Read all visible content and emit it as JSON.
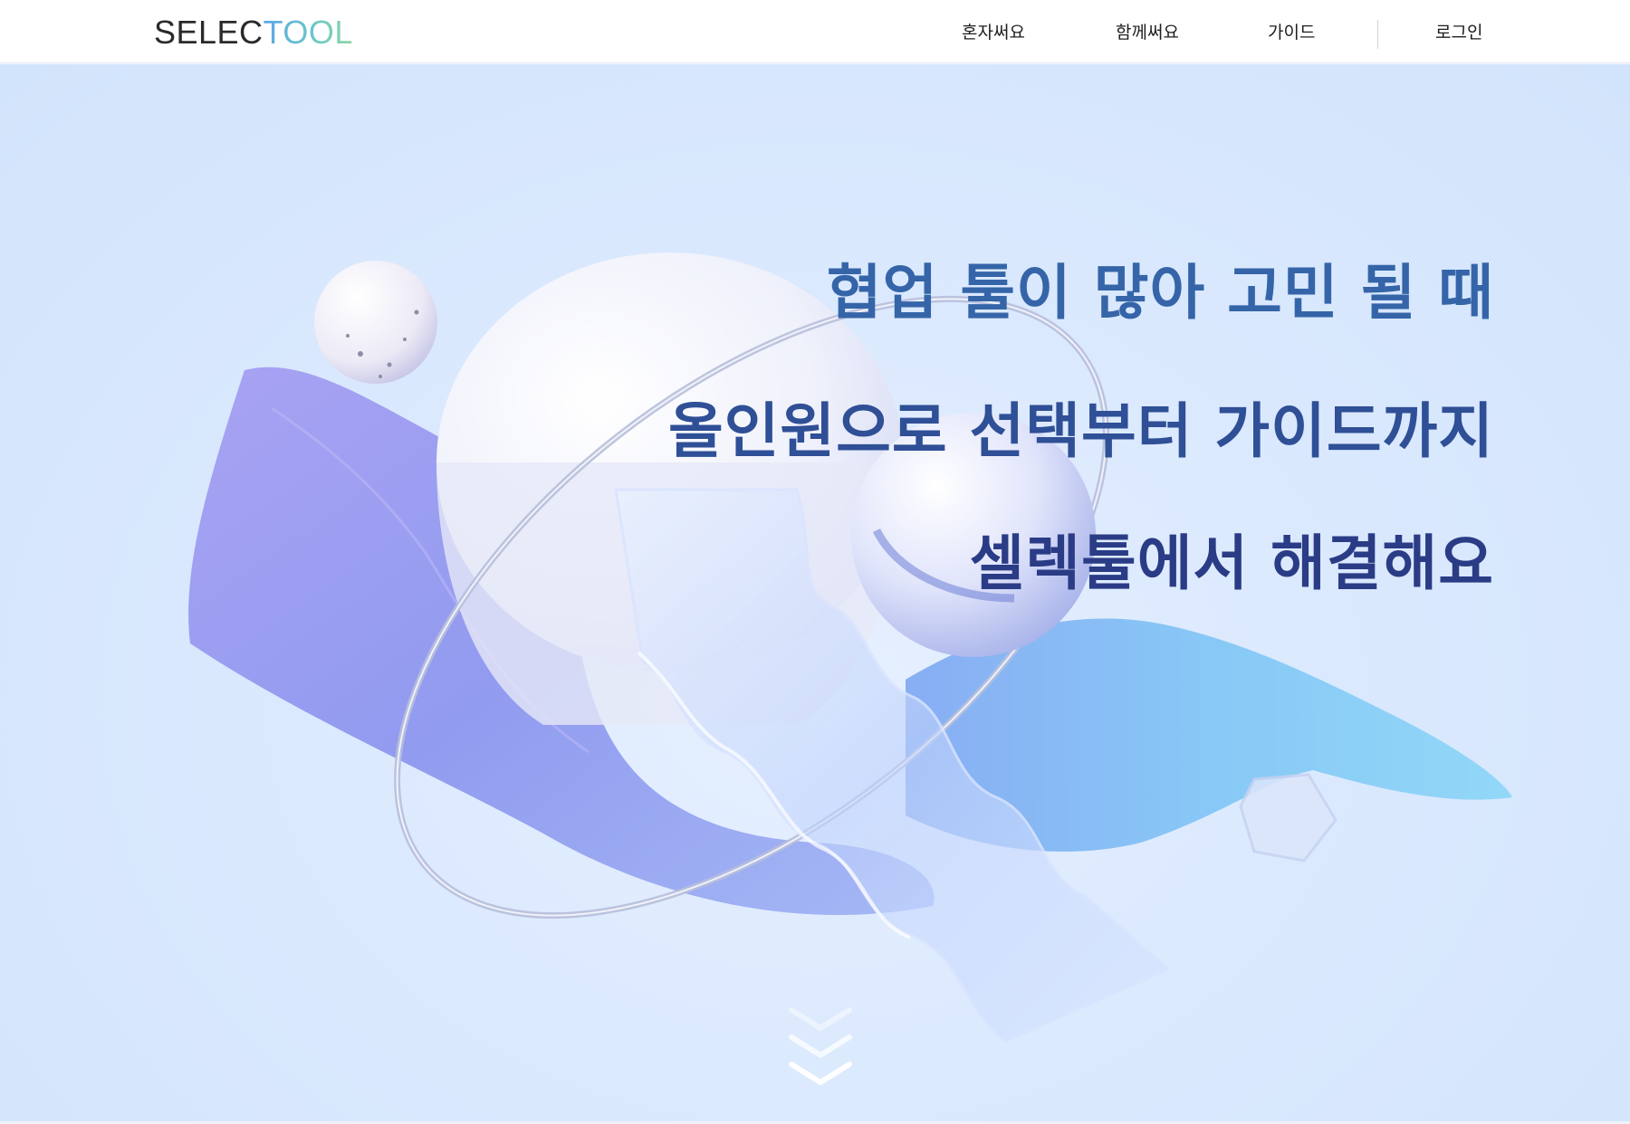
{
  "header": {
    "logo": {
      "part1": "SELEC",
      "part2": "TOOL"
    },
    "nav": [
      {
        "label": "혼자써요"
      },
      {
        "label": "함께써요"
      },
      {
        "label": "가이드"
      }
    ],
    "login_label": "로그인"
  },
  "hero": {
    "line1": "협업 툴이 많아 고민 될 때",
    "line2": "올인원으로 선택부터 가이드까지",
    "line3": "셀렉툴에서 해결해요"
  },
  "colors": {
    "headline_1": "#3565a8",
    "headline_2": "#2f4f96",
    "headline_3": "#2b3c86",
    "logo_gradient": [
      "#5aa8e6",
      "#6cc9c4",
      "#8fd6a3"
    ]
  },
  "icons": {
    "scroll": "chevron-double-down-icon"
  }
}
